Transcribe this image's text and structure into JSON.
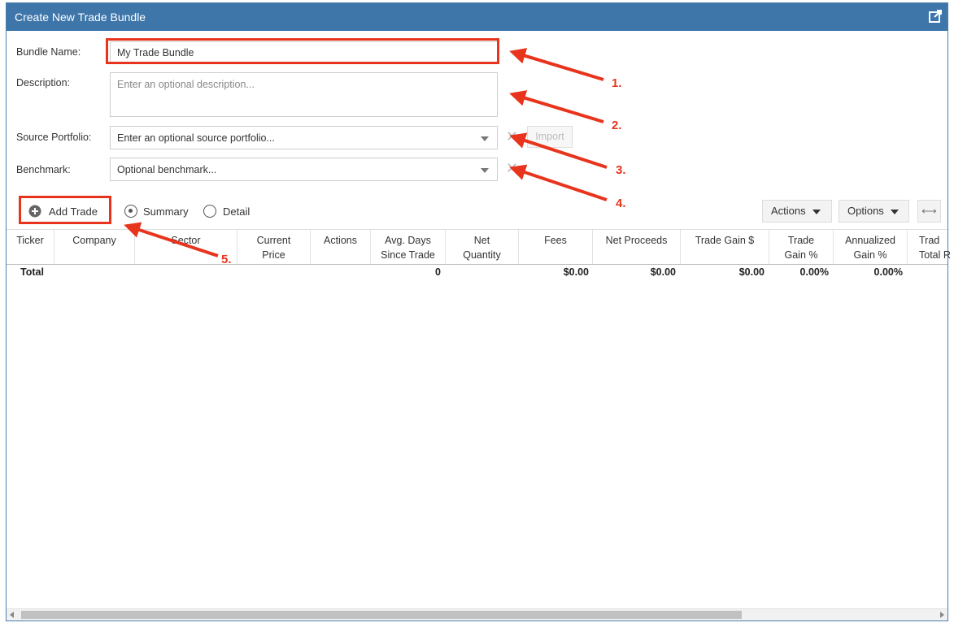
{
  "window": {
    "title": "Create New Trade Bundle",
    "popout_icon": "external-link-icon"
  },
  "form": {
    "bundle_name_label": "Bundle Name:",
    "bundle_name_value": "My Trade Bundle",
    "description_label": "Description:",
    "description_placeholder": "Enter an optional description...",
    "source_portfolio_label": "Source Portfolio:",
    "source_portfolio_placeholder": "Enter an optional source portfolio...",
    "import_label": "Import",
    "benchmark_label": "Benchmark:",
    "benchmark_placeholder": "Optional benchmark...",
    "clear_glyph": "✕"
  },
  "toolbar": {
    "add_trade_label": "Add Trade",
    "summary_label": "Summary",
    "detail_label": "Detail",
    "actions_label": "Actions",
    "options_label": "Options",
    "expand_glyph": "⟷"
  },
  "grid": {
    "columns": [
      [
        "Ticker",
        ""
      ],
      [
        "Company",
        ""
      ],
      [
        "Sector",
        ""
      ],
      [
        "Current",
        "Price"
      ],
      [
        "Actions",
        ""
      ],
      [
        "Avg. Days",
        "Since Trade"
      ],
      [
        "Net",
        "Quantity"
      ],
      [
        "Fees",
        ""
      ],
      [
        "Net Proceeds",
        ""
      ],
      [
        "Trade Gain $",
        ""
      ],
      [
        "Trade",
        "Gain %"
      ],
      [
        "Annualized",
        "Gain %"
      ],
      [
        "Trad",
        "Total R"
      ]
    ],
    "total": {
      "label": "Total",
      "avg_days": "0",
      "fees": "$0.00",
      "net_proceeds": "$0.00",
      "trade_gain": "$0.00",
      "trade_gain_pct": "0.00%",
      "annualized_gain_pct": "0.00%"
    }
  },
  "annotations": [
    "1.",
    "2.",
    "3.",
    "4.",
    "5."
  ],
  "colors": {
    "titlebar": "#3e76aa",
    "annotation": "#e8341c"
  }
}
